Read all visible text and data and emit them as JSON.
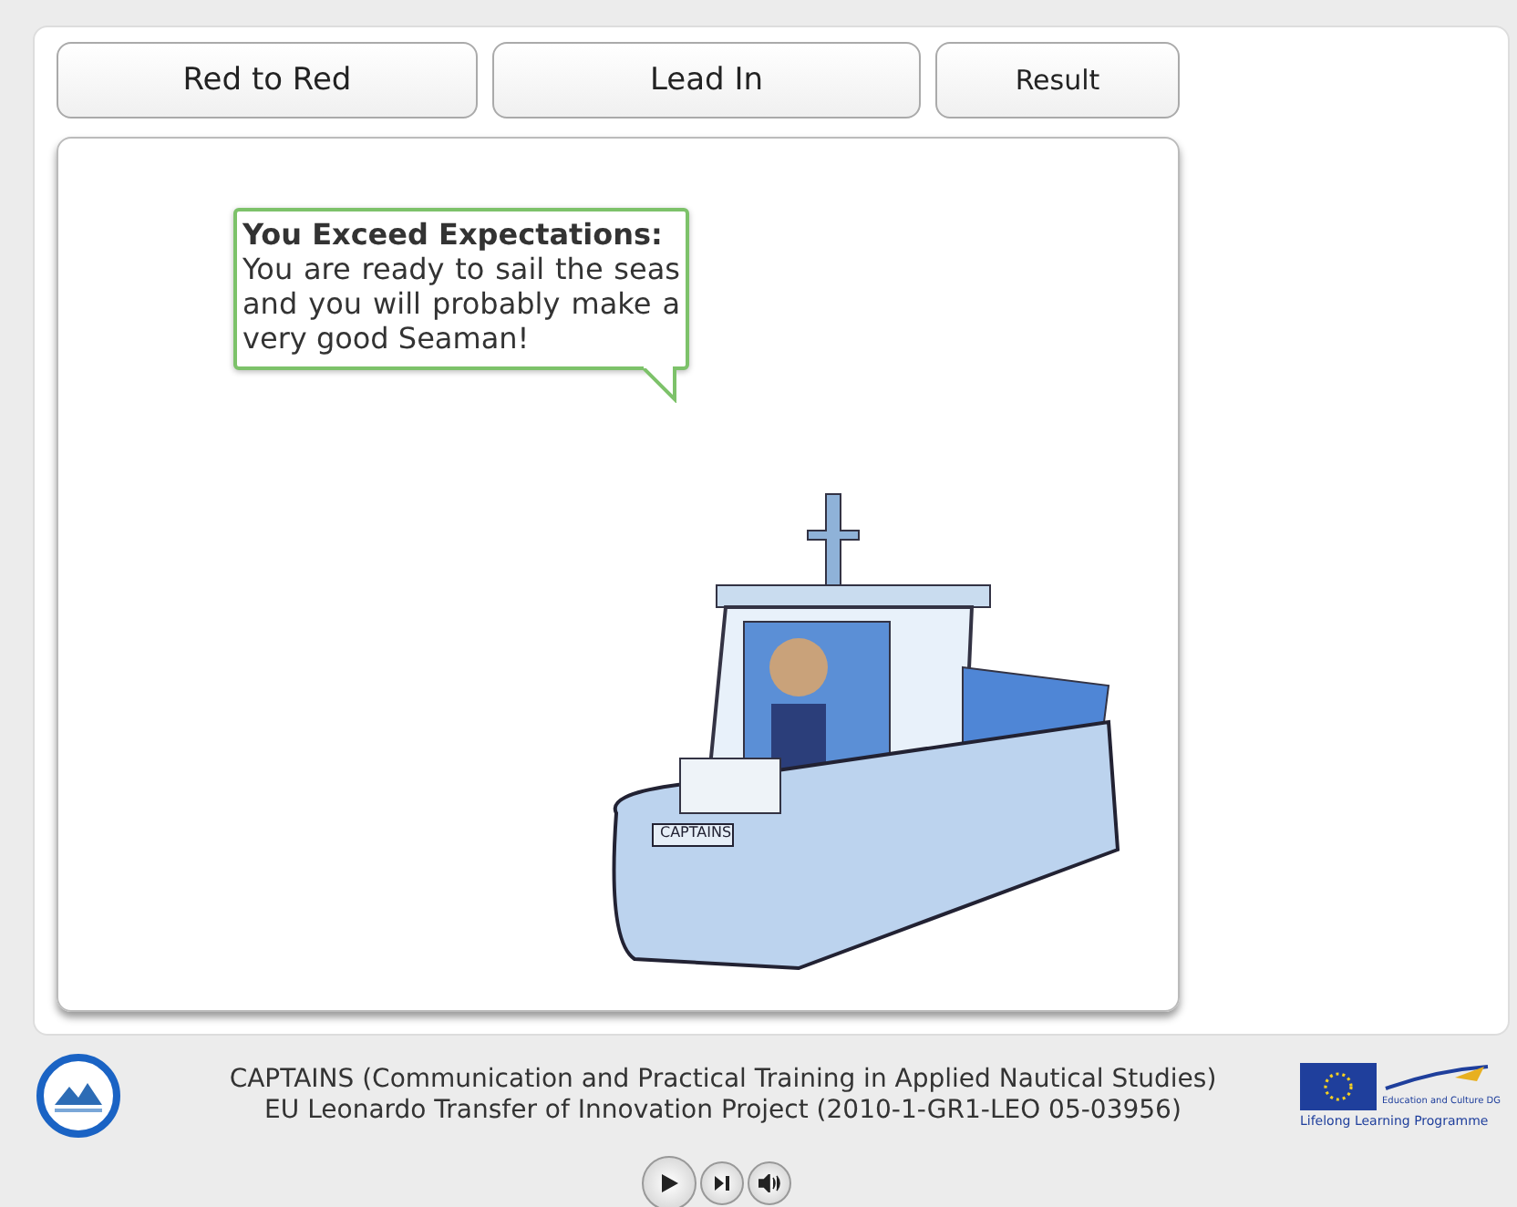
{
  "tabs": [
    {
      "label": "Red to Red",
      "kind": "large"
    },
    {
      "label": "Lead In",
      "kind": "large"
    },
    {
      "label": "Result",
      "kind": "small"
    }
  ],
  "feedback": {
    "heading": "You Exceed Expectations:",
    "message": "You are ready to sail the seas and you will probably make a very good Seaman!"
  },
  "illustration": {
    "boat_name": "CAPTAINS"
  },
  "footer": {
    "lines": [
      "CAPTAINS (Communication and Practical Training in Applied Nautical Studies)",
      "EU Leonardo Transfer of Innovation Project (2010-1-GR1-LEO 05-03956)"
    ],
    "eu_logo": {
      "caption": "Education and Culture DG",
      "programme": "Lifelong Learning Programme"
    }
  },
  "controls": [
    {
      "kind": "play"
    },
    {
      "kind": "next"
    },
    {
      "kind": "sound"
    }
  ]
}
